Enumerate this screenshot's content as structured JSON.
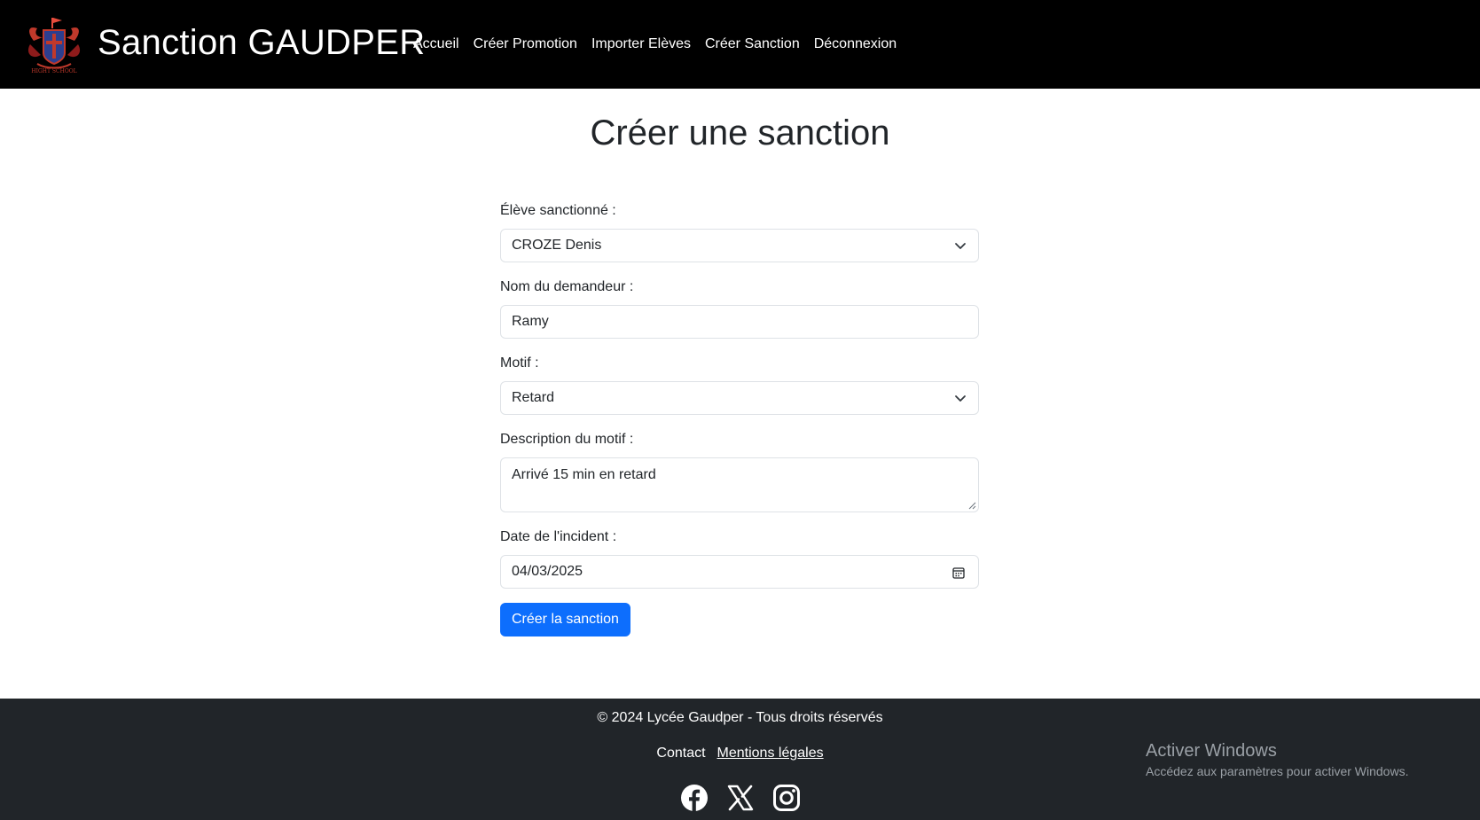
{
  "header": {
    "brand": "Sanction GAUDPER",
    "logo_icon": "school-crest-icon",
    "nav": [
      {
        "label": "Accueil"
      },
      {
        "label": "Créer Promotion"
      },
      {
        "label": "Importer Elèves"
      },
      {
        "label": "Créer Sanction"
      },
      {
        "label": "Déconnexion"
      }
    ]
  },
  "main": {
    "title": "Créer une sanction",
    "form": {
      "eleve": {
        "label": "Élève sanctionné :",
        "value": "CROZE Denis"
      },
      "demandeur": {
        "label": "Nom du demandeur :",
        "value": "Ramy"
      },
      "motif": {
        "label": "Motif :",
        "value": "Retard"
      },
      "description": {
        "label": "Description du motif :",
        "value": "Arrivé 15 min en retard"
      },
      "date": {
        "label": "Date de l'incident :",
        "value": "04/03/2025"
      },
      "submit_label": "Créer la sanction"
    }
  },
  "footer": {
    "copyright": "© 2024 Lycée Gaudper - Tous droits réservés",
    "links": [
      {
        "label": "Contact"
      },
      {
        "label": "Mentions légales"
      }
    ],
    "social": [
      "facebook-icon",
      "x-icon",
      "instagram-icon"
    ]
  },
  "watermark": {
    "title": "Activer Windows",
    "subtitle": "Accédez aux paramètres pour activer Windows."
  },
  "colors": {
    "header_bg": "#000000",
    "footer_bg": "#212529",
    "primary": "#0d6efd"
  }
}
